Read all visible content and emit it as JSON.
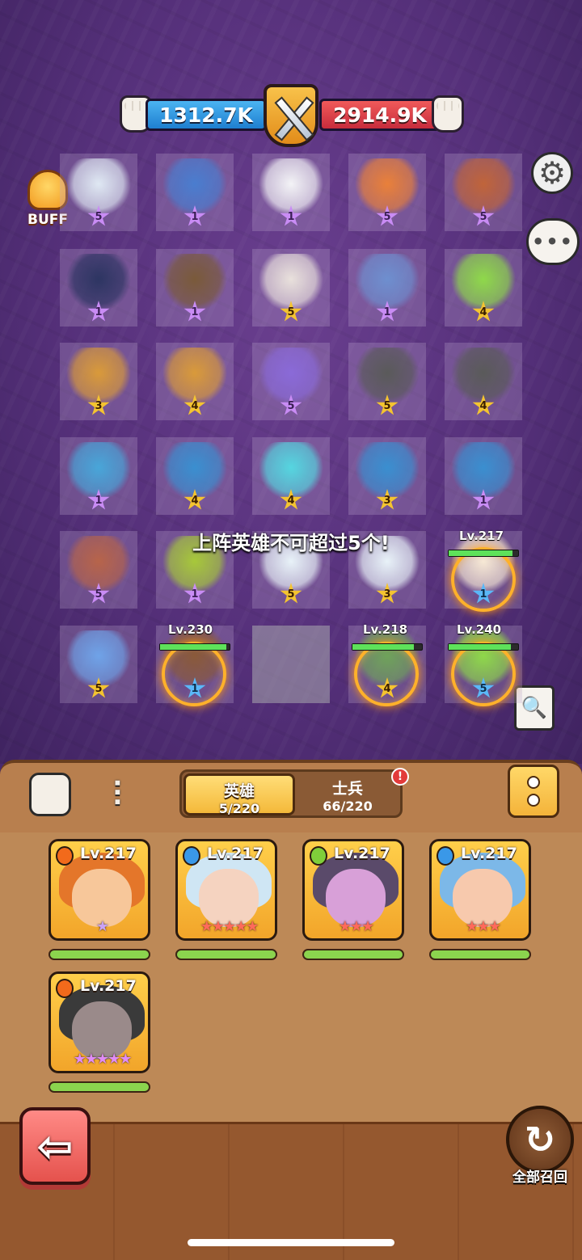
{
  "power": {
    "player": "1312.7K",
    "enemy": "2914.9K"
  },
  "buff_label": "BUFF",
  "warning": "上阵英雄不可超过5个!",
  "grid": [
    {
      "star": "5",
      "color": "purple",
      "unit": "#dfe8f3"
    },
    {
      "star": "1",
      "color": "purple",
      "unit": "#4a7dcf"
    },
    {
      "star": "1",
      "color": "purple",
      "unit": "#f3f3f6"
    },
    {
      "star": "5",
      "color": "purple",
      "unit": "#e9803a"
    },
    {
      "star": "5",
      "color": "purple",
      "unit": "#c0643a"
    },
    {
      "star": "1",
      "color": "purple",
      "unit": "#2d3562"
    },
    {
      "star": "1",
      "color": "purple",
      "unit": "#7a5a3a"
    },
    {
      "star": "5",
      "color": "gold",
      "unit": "#e9e1dc"
    },
    {
      "star": "1",
      "color": "purple",
      "unit": "#6e8fcf"
    },
    {
      "star": "4",
      "color": "gold",
      "unit": "#8fd94a"
    },
    {
      "star": "3",
      "color": "gold",
      "unit": "#d99a3a"
    },
    {
      "star": "4",
      "color": "gold",
      "unit": "#d99a3a"
    },
    {
      "star": "5",
      "color": "purple",
      "unit": "#8a6ad8"
    },
    {
      "star": "5",
      "color": "gold",
      "unit": "#5a5a5a"
    },
    {
      "star": "4",
      "color": "gold",
      "unit": "#5a5a5a"
    },
    {
      "star": "1",
      "color": "purple",
      "unit": "#48a6d9"
    },
    {
      "star": "4",
      "color": "gold",
      "unit": "#3a8fd0"
    },
    {
      "star": "4",
      "color": "gold",
      "unit": "#55d6e0"
    },
    {
      "star": "3",
      "color": "gold",
      "unit": "#3a8fd0"
    },
    {
      "star": "1",
      "color": "purple",
      "unit": "#3a8fd0"
    },
    {
      "star": "5",
      "color": "purple",
      "unit": "#b7644a"
    },
    {
      "star": "1",
      "color": "purple",
      "unit": "#a7c83a"
    },
    {
      "star": "5",
      "color": "gold",
      "unit": "#e8f2f8"
    },
    {
      "star": "3",
      "color": "gold",
      "unit": "#e8f2f8"
    },
    {
      "star": "1",
      "color": "blue",
      "unit": "#f7e9d5"
    },
    {
      "star": "5",
      "color": "gold",
      "unit": "#6fa3e8"
    },
    {
      "star": "1",
      "color": "blue",
      "unit": "#8a5a3a"
    },
    {
      "star": "",
      "color": "none",
      "unit": ""
    },
    {
      "star": "4",
      "color": "gold",
      "unit": "#6fa35a"
    },
    {
      "star": "5",
      "color": "blue",
      "unit": "#8fd94a"
    }
  ],
  "deployed": [
    {
      "level": "Lv.217",
      "hp": 0.92
    },
    {
      "level": "Lv.230",
      "hp": 0.95
    },
    {
      "level": "Lv.218",
      "hp": 0.88
    },
    {
      "level": "Lv.240",
      "hp": 0.9
    }
  ],
  "tabs": {
    "heroes": {
      "label": "英雄",
      "count": "5/220"
    },
    "soldiers": {
      "label": "士兵",
      "count": "66/220"
    },
    "alert": "!"
  },
  "heroes": [
    {
      "level": "Lv.217",
      "element": "fire",
      "elem_color": "#f26a1b",
      "stars": "★",
      "star_color": "#c9a2f5",
      "hair": "#e4762a",
      "face": "#f7c79a",
      "bg": "#ffcf4a"
    },
    {
      "level": "Lv.217",
      "element": "water",
      "elem_color": "#3a98e8",
      "stars": "★★★★★",
      "star_color": "#ff6a5a",
      "hair": "#cfe6f4",
      "face": "#f5d3c0",
      "bg": "#ffcf4a"
    },
    {
      "level": "Lv.217",
      "element": "leaf",
      "elem_color": "#7fcf3a",
      "stars": "★★★",
      "star_color": "#ff6a5a",
      "hair": "#5a4a6a",
      "face": "#d8a0d8",
      "bg": "#ffcf4a"
    },
    {
      "level": "Lv.217",
      "element": "water",
      "elem_color": "#3a98e8",
      "stars": "★★★",
      "star_color": "#ff6a5a",
      "hair": "#7cb8e8",
      "face": "#f7c9ad",
      "bg": "#ffcf4a"
    },
    {
      "level": "Lv.217",
      "element": "fire",
      "elem_color": "#f26a1b",
      "stars": "★★★★★",
      "star_color": "#e08cf5",
      "hair": "#3a3a3a",
      "face": "#9a8a8a",
      "bg": "#ffcf4a"
    }
  ],
  "recall_label": "全部召回",
  "icons": {
    "settings": "gear-icon",
    "chat": "chat-bubble-icon",
    "report": "battle-report-icon",
    "back": "arrow-left-icon",
    "recall": "recall-icon",
    "filter": "filter-icon",
    "power": "fist-icon",
    "menu": "more-icon"
  }
}
